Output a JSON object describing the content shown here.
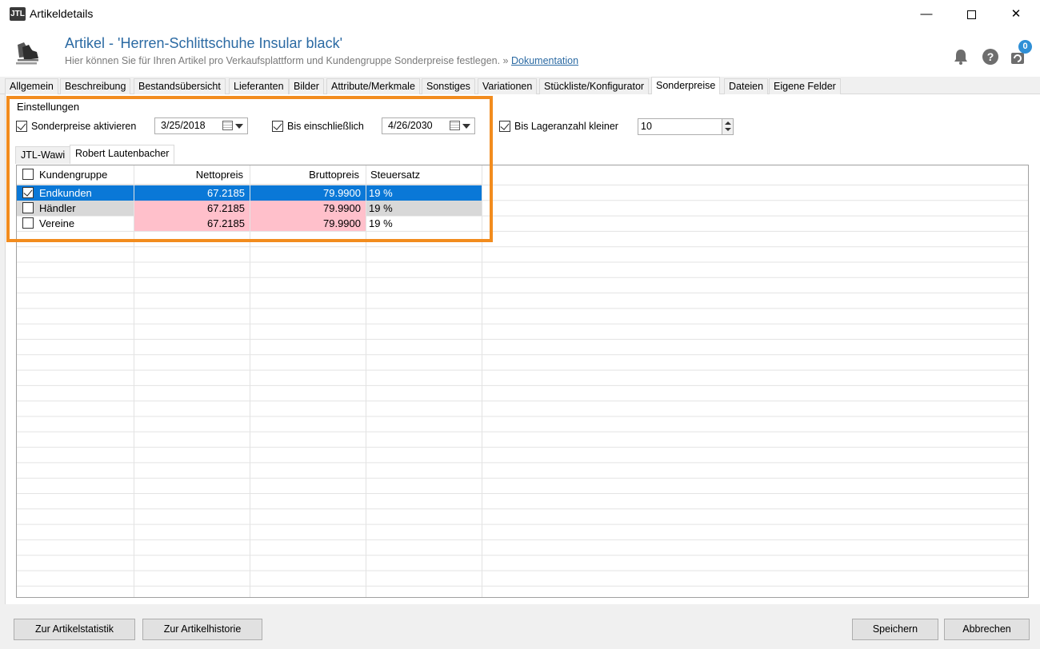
{
  "window": {
    "title": "Artikeldetails",
    "logo_text": "JTL",
    "minimize_symbol": "—",
    "close_symbol": "✕"
  },
  "header": {
    "title": "Artikel - 'Herren-Schlittschuhe Insular black'",
    "subtitle": "Hier können Sie für Ihren Artikel pro Verkaufsplattform und Kundengruppe Sonderpreise festlegen. »",
    "doc_link": "Dokumentation",
    "notification_count": "0",
    "accent_color": "#2b6aa3"
  },
  "tabs": [
    "Allgemein",
    "Beschreibung",
    "Bestandsübersicht",
    "Lieferanten",
    "Bilder",
    "Attribute/Merkmale",
    "Sonstiges",
    "Variationen",
    "Stückliste/Konfigurator",
    "Sonderpreise",
    "Dateien",
    "Eigene Felder"
  ],
  "active_tab": "Sonderpreise",
  "settings": {
    "group_label": "Einstellungen",
    "enable_label": "Sonderpreise aktivieren",
    "enable_checked": true,
    "start_date": "3/25/2018",
    "until_label": "Bis einschließlich",
    "until_checked": true,
    "end_date": "4/26/2030",
    "stock_label": "Bis Lageranzahl kleiner",
    "stock_checked": true,
    "stock_value": "10"
  },
  "platform_tabs": [
    "JTL-Wawi",
    "Robert Lautenbacher"
  ],
  "active_platform_tab": "Robert Lautenbacher",
  "table": {
    "columns": [
      "Kundengruppe",
      "Nettopreis",
      "Bruttopreis",
      "Steuersatz"
    ],
    "rows": [
      {
        "group": "Endkunden",
        "net": "67.2185",
        "gross": "79.9900",
        "tax": "19 %",
        "checked": true,
        "selected": true
      },
      {
        "group": "Händler",
        "net": "67.2185",
        "gross": "79.9900",
        "tax": "19 %",
        "checked": false,
        "selected": false
      },
      {
        "group": "Vereine",
        "net": "67.2185",
        "gross": "79.9900",
        "tax": "19 %",
        "checked": false,
        "selected": false
      }
    ]
  },
  "footer": {
    "statistics_button": "Zur Artikelstatistik",
    "history_button": "Zur Artikelhistorie",
    "save_button": "Speichern",
    "cancel_button": "Abbrechen"
  },
  "highlight_color": "#f28c1e",
  "icons": [
    "bell-icon",
    "help-icon",
    "sync-icon",
    "calendar-icon",
    "dropdown-arrow-icon",
    "skates-icon"
  ]
}
